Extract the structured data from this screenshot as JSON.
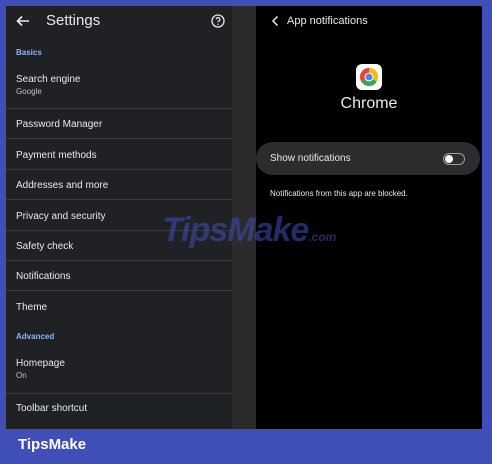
{
  "settings": {
    "title": "Settings",
    "basics_label": "Basics",
    "advanced_label": "Advanced",
    "items": [
      {
        "label": "Search engine",
        "sub": "Google"
      },
      {
        "label": "Password Manager"
      },
      {
        "label": "Payment methods"
      },
      {
        "label": "Addresses and more"
      },
      {
        "label": "Privacy and security"
      },
      {
        "label": "Safety check"
      },
      {
        "label": "Notifications"
      },
      {
        "label": "Theme"
      }
    ],
    "advanced_items": [
      {
        "label": "Homepage",
        "sub": "On"
      },
      {
        "label": "Toolbar shortcut"
      }
    ]
  },
  "app_notifications": {
    "title": "App notifications",
    "app_name": "Chrome",
    "toggle_label": "Show notifications",
    "toggle_on": false,
    "blocked_message": "Notifications from this app are blocked."
  },
  "watermark": {
    "text": "TipsMake",
    "suffix": ".com"
  },
  "footer": {
    "brand": "TipsMake"
  },
  "colors": {
    "accent": "#8ab4f8",
    "footer_bg": "#3f4fb7"
  }
}
